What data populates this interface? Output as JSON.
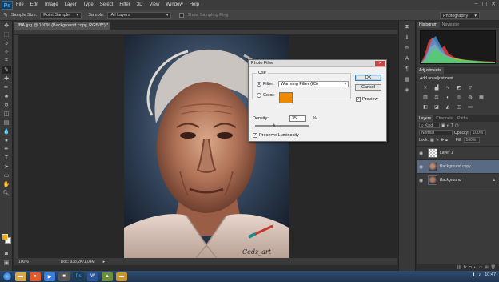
{
  "app": {
    "logo": "Ps",
    "menu": [
      "File",
      "Edit",
      "Image",
      "Layer",
      "Type",
      "Select",
      "Filter",
      "3D",
      "View",
      "Window",
      "Help"
    ],
    "window_controls": [
      "–",
      "▢",
      "✕"
    ]
  },
  "options_bar": {
    "sample_size_label": "Sample Size:",
    "sample_size_value": "Point Sample",
    "sample_label": "Sample:",
    "sample_value": "All Layers",
    "show_ring_label": "Show Sampling Ring",
    "workspace": "Photography"
  },
  "document": {
    "tab_title": "JBA.jpg @ 100% (Background copy, RGB/8*) *",
    "zoom": "100%",
    "doc_info": "Doc: 938,2K/1,04M",
    "watermark": "Cedz_art"
  },
  "dialog": {
    "title": "Photo Filter",
    "use_label": "Use",
    "filter_label": "Filter:",
    "filter_value": "Warming Filter (85)",
    "color_label": "Color:",
    "color_value": "#ec8a00",
    "density_label": "Density:",
    "density_value": "35",
    "density_unit": "%",
    "density_level": 0.35,
    "preserve_label": "Preserve Luminosity",
    "preserve_checked": true,
    "ok_label": "OK",
    "cancel_label": "Cancel",
    "preview_label": "Preview",
    "preview_checked": true
  },
  "panels": {
    "histogram_tabs": [
      "Histogram",
      "Navigator"
    ],
    "adjustments_tab": "Adjustments",
    "adjustments_title": "Add an adjustment",
    "layers_tabs": [
      "Layers",
      "Channels",
      "Paths"
    ],
    "kind_label": "Kind",
    "blend_mode": "Normal",
    "opacity_label": "Opacity:",
    "opacity_value": "100%",
    "lock_label": "Lock:",
    "fill_label": "Fill:",
    "fill_value": "100%",
    "layers": [
      {
        "name": "Layer 1",
        "selected": false,
        "locked": false
      },
      {
        "name": "Background copy",
        "selected": true,
        "locked": false
      },
      {
        "name": "Background",
        "selected": false,
        "locked": true
      }
    ]
  },
  "taskbar": {
    "time": "10:47"
  },
  "colors": {
    "foreground": "#f2a900",
    "background": "#ffffff",
    "accent": "#5a6a82"
  }
}
